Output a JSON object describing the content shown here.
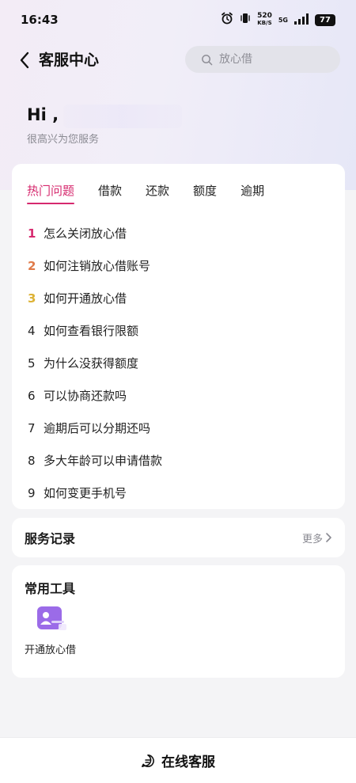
{
  "status_bar": {
    "time": "16:43",
    "net_speed_value": "520",
    "net_speed_unit": "KB/S",
    "network": "5G",
    "battery": "77"
  },
  "header": {
    "title": "客服中心",
    "search_placeholder": "放心借"
  },
  "greeting": {
    "hi": "Hi ,",
    "subtitle": "很高兴为您服务"
  },
  "faq": {
    "tabs": [
      {
        "label": "热门问题",
        "active": true
      },
      {
        "label": "借款"
      },
      {
        "label": "还款"
      },
      {
        "label": "额度"
      },
      {
        "label": "逾期"
      }
    ],
    "items": [
      {
        "num": "1",
        "text": "怎么关闭放心借"
      },
      {
        "num": "2",
        "text": "如何注销放心借账号"
      },
      {
        "num": "3",
        "text": "如何开通放心借"
      },
      {
        "num": "4",
        "text": "如何查看银行限额"
      },
      {
        "num": "5",
        "text": "为什么没获得额度"
      },
      {
        "num": "6",
        "text": "可以协商还款吗"
      },
      {
        "num": "7",
        "text": "逾期后可以分期还吗"
      },
      {
        "num": "8",
        "text": "多大年龄可以申请借款"
      },
      {
        "num": "9",
        "text": "如何变更手机号"
      }
    ]
  },
  "service_record": {
    "title": "服务记录",
    "more": "更多"
  },
  "tools": {
    "title": "常用工具",
    "items": [
      {
        "label": "开通放心借",
        "icon": "id-card-icon"
      }
    ]
  },
  "bottom": {
    "label": "在线客服"
  },
  "colors": {
    "accent": "#d6296e",
    "rank2": "#e07a49",
    "rank3": "#ddb234",
    "tool_icon": "#9b6be8"
  }
}
